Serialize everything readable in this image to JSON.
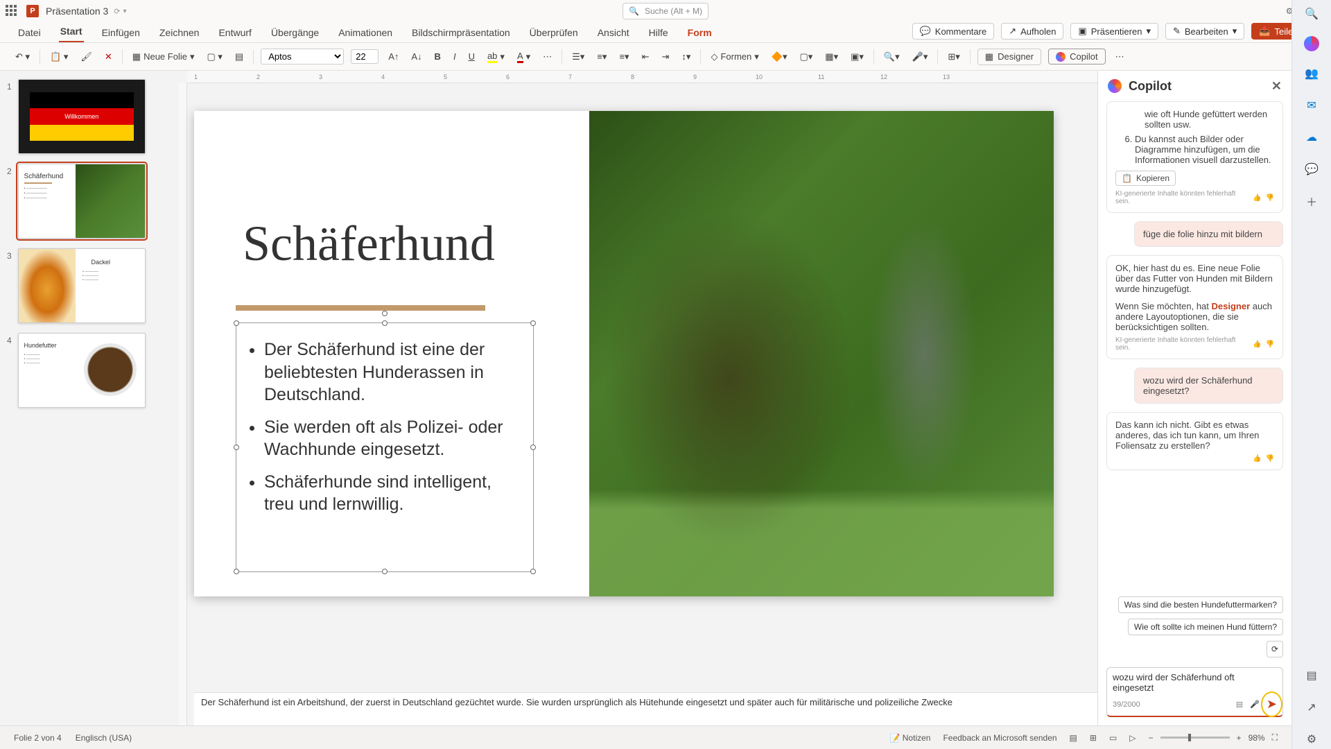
{
  "titlebar": {
    "doc_name": "Präsentation 3",
    "search_placeholder": "Suche (Alt + M)"
  },
  "menubar": {
    "items": [
      "Datei",
      "Start",
      "Einfügen",
      "Zeichnen",
      "Entwurf",
      "Übergänge",
      "Animationen",
      "Bildschirmpräsentation",
      "Überprüfen",
      "Ansicht",
      "Hilfe",
      "Form"
    ],
    "right": {
      "comments": "Kommentare",
      "catchup": "Aufholen",
      "present": "Präsentieren",
      "edit": "Bearbeiten",
      "share": "Teilen"
    }
  },
  "toolbar": {
    "new_slide": "Neue Folie",
    "font_name": "Aptos",
    "font_size": "22",
    "shapes": "Formen",
    "designer": "Designer",
    "copilot": "Copilot"
  },
  "ruler": [
    "",
    "1",
    "2",
    "3",
    "4",
    "5",
    "6",
    "7",
    "8",
    "9",
    "10",
    "11",
    "12",
    "13"
  ],
  "thumbs": [
    {
      "num": "1",
      "title": "Willkommen"
    },
    {
      "num": "2",
      "title": "Schäferhund"
    },
    {
      "num": "3",
      "title": "Dackel"
    },
    {
      "num": "4",
      "title": "Hundefutter"
    }
  ],
  "slide": {
    "title": "Schäferhund",
    "bullets": [
      "Der Schäferhund ist eine der beliebtesten Hunderassen in Deutschland.",
      "Sie werden oft als Polizei- oder Wachhunde eingesetzt.",
      "Schäferhunde sind intelligent, treu und lernwillig."
    ]
  },
  "notes": "Der Schäferhund ist ein Arbeitshund, der zuerst in Deutschland gezüchtet wurde. Sie wurden ursprünglich als Hütehunde eingesetzt und später auch für militärische und polizeiliche Zwecke",
  "copilot": {
    "title": "Copilot",
    "msg1_line1": "wie oft Hunde gefüttert werden sollten usw.",
    "msg1_item5": "Du kannst auch Bilder oder Diagramme hinzufügen, um die Informationen visuell darzustellen.",
    "copy": "Kopieren",
    "disclaimer": "KI-generierte Inhalte könnten fehlerhaft sein.",
    "user1": "füge die folie hinzu mit bildern",
    "msg2_a": "OK, hier hast du es. Eine neue Folie über das Futter von Hunden mit Bildern wurde hinzugefügt.",
    "msg2_b_pre": "Wenn Sie möchten, hat ",
    "msg2_b_link": "Designer",
    "msg2_b_post": " auch andere Layoutoptionen, die sie berücksichtigen sollten.",
    "user2": "wozu wird der Schäferhund eingesetzt?",
    "msg3": "Das kann ich nicht. Gibt es etwas anderes, das ich tun kann, um Ihren Foliensatz zu erstellen?",
    "sugg1": "Was sind die besten Hundefuttermarken?",
    "sugg2": "Wie oft sollte ich meinen Hund füttern?",
    "input_text": "wozu wird der Schäferhund oft eingesetzt",
    "counter": "39/2000"
  },
  "statusbar": {
    "slide_info": "Folie 2 von 4",
    "lang": "Englisch (USA)",
    "notes": "Notizen",
    "feedback": "Feedback an Microsoft senden",
    "zoom": "98%"
  }
}
